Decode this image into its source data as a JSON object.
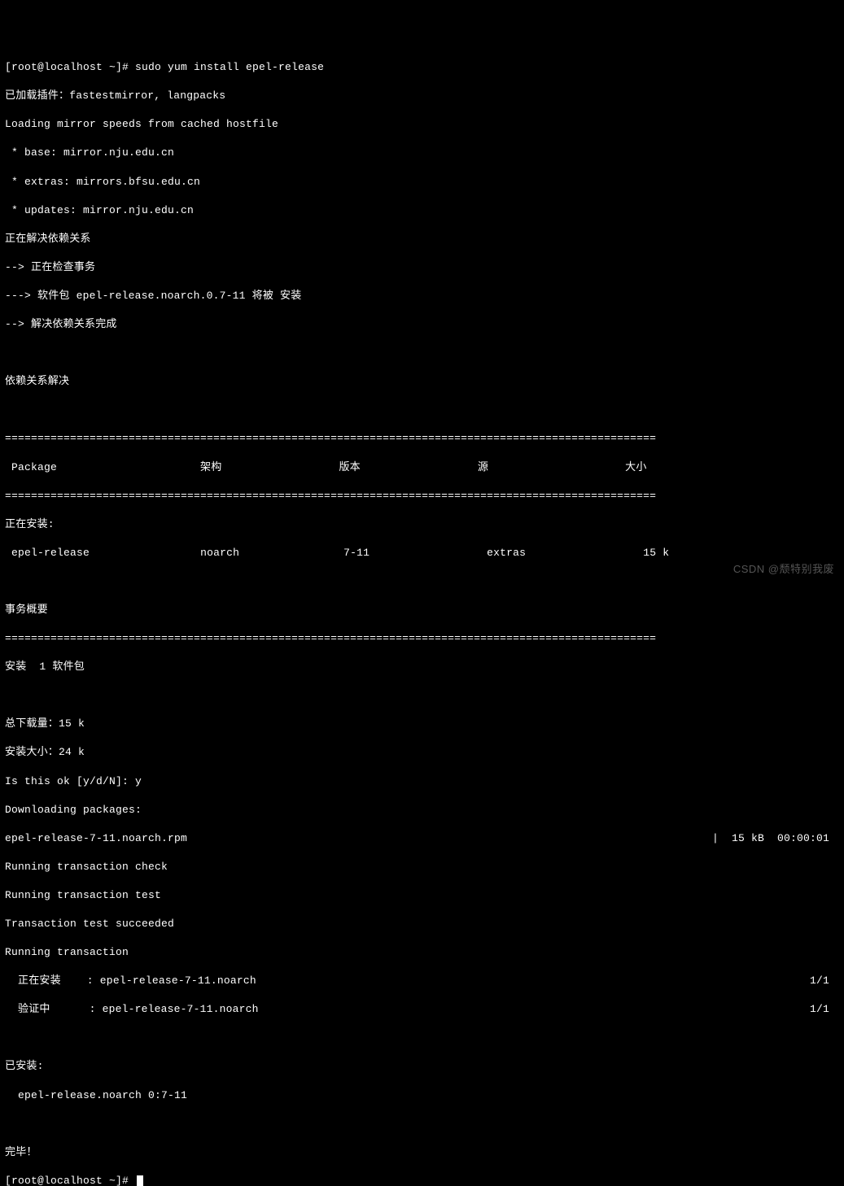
{
  "prompt1_user": "[root@localhost ~]# ",
  "prompt1_cmd": "sudo yum install epel-release",
  "plugins_line": "已加载插件：fastestmirror, langpacks",
  "mirror_loading": "Loading mirror speeds from cached hostfile",
  "mirror_base": " * base: mirror.nju.edu.cn",
  "mirror_extras": " * extras: mirrors.bfsu.edu.cn",
  "mirror_updates": " * updates: mirror.nju.edu.cn",
  "resolve_start": "正在解决依赖关系",
  "checking_tx": "--> 正在检查事务",
  "pkg_line": "---> 软件包 epel-release.noarch.0.7-11 将被 安装",
  "resolve_done": "--> 解决依赖关系完成",
  "deps_resolved": "依赖关系解决",
  "hr": "====================================================================================================",
  "th_package": " Package",
  "th_arch": "架构",
  "th_version": "版本",
  "th_repo": "源",
  "th_size": "大小",
  "installing_hdr": "正在安装:",
  "row_pkg": " epel-release",
  "row_arch": "noarch",
  "row_ver": "7-11",
  "row_repo": "extras",
  "row_size": "15 k",
  "tx_summary": "事务概要",
  "install_count": "安装  1 软件包",
  "total_dl": "总下载量：15 k",
  "install_size": "安装大小：24 k",
  "confirm_prompt": "Is this ok [y/d/N]: y",
  "downloading": "Downloading packages:",
  "rpm_left": "epel-release-7-11.noarch.rpm",
  "rpm_right": "|  15 kB  00:00:01",
  "run_check": "Running transaction check",
  "run_test": "Running transaction test",
  "tx_succeed": "Transaction test succeeded",
  "run_tx": "Running transaction",
  "install_step_left": "  正在安装    : epel-release-7-11.noarch",
  "install_step_right": "1/1",
  "verify_step_left": "  验证中      : epel-release-7-11.noarch",
  "verify_step_right": "1/1",
  "installed_hdr": "已安装:",
  "installed_pkg": "  epel-release.noarch 0:7-11",
  "complete": "完毕！",
  "prompt2_user": "[root@localhost ~]# ",
  "watermark": "CSDN @颓特别我废"
}
